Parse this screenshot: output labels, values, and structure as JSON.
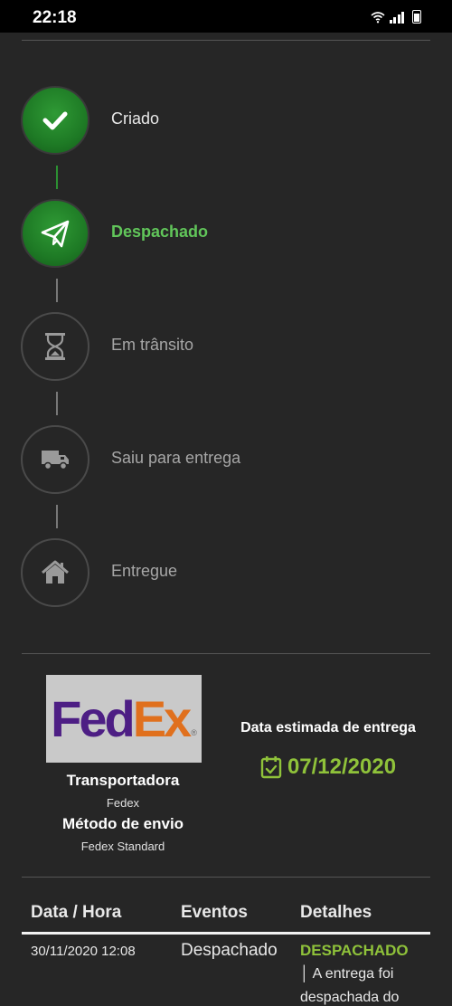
{
  "status_bar": {
    "time": "22:18"
  },
  "steps": [
    {
      "label": "Criado",
      "state": "done",
      "icon": "check-icon"
    },
    {
      "label": "Despachado",
      "state": "active",
      "icon": "paper-plane-icon"
    },
    {
      "label": "Em trânsito",
      "state": "pending",
      "icon": "hourglass-icon"
    },
    {
      "label": "Saiu para entrega",
      "state": "pending",
      "icon": "truck-icon"
    },
    {
      "label": "Entregue",
      "state": "pending",
      "icon": "home-icon"
    }
  ],
  "carrier": {
    "logo_text_fed": "Fed",
    "logo_text_ex": "Ex",
    "carrier_label": "Transportadora",
    "carrier_value": "Fedex",
    "method_label": "Método de envio",
    "method_value": "Fedex Standard"
  },
  "estimate": {
    "title": "Data estimada de entrega",
    "date": "07/12/2020",
    "color": "#8fc23a"
  },
  "events_table": {
    "headers": [
      "Data / Hora",
      "Eventos",
      "Detalhes"
    ],
    "rows": [
      {
        "datetime": "30/11/2020 12:08",
        "event": "Despachado",
        "detail_status": "DESPACHADO",
        "detail_text_1": "│ A entrega foi",
        "detail_text_2": "despachada do"
      }
    ]
  },
  "colors": {
    "background": "#262626",
    "success_green": "#1e7a25",
    "active_label": "#61c65a",
    "accent_lime": "#8fc23a"
  }
}
